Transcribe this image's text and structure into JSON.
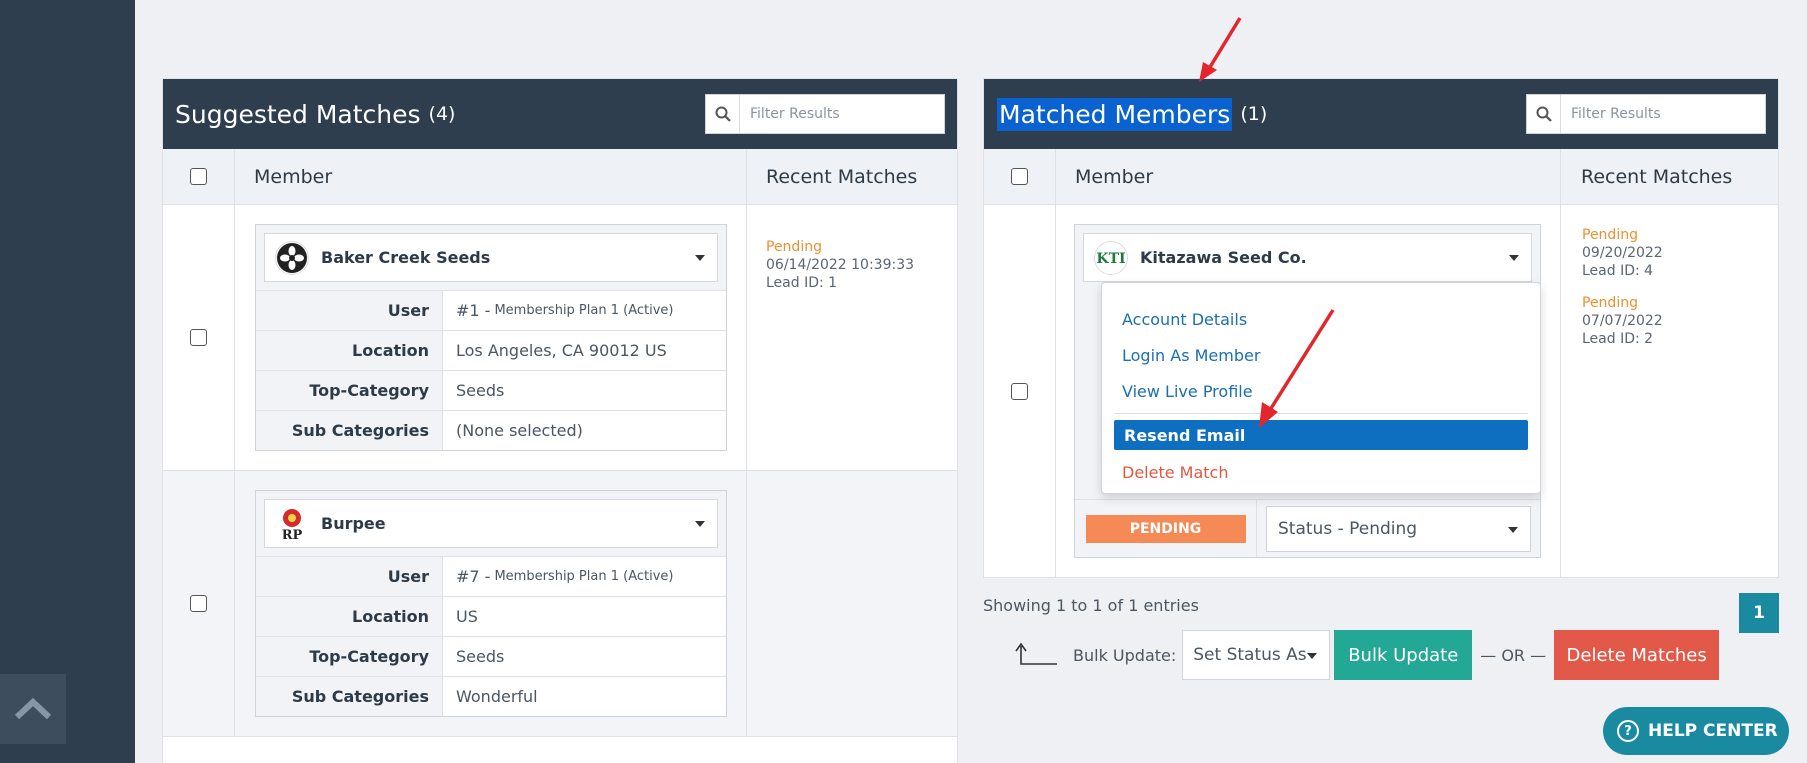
{
  "suggested": {
    "title": "Suggested Matches",
    "count": "(4)",
    "filter_placeholder": "Filter Results",
    "col_member": "Member",
    "col_recent": "Recent Matches",
    "rows": [
      {
        "name": "Baker Creek Seeds",
        "user_label": "User",
        "user_value": "#1 -",
        "user_plan": "Membership Plan 1 (Active)",
        "location_label": "Location",
        "location_value": "Los Angeles, CA 90012 US",
        "topcat_label": "Top-Category",
        "topcat_value": "Seeds",
        "subcat_label": "Sub Categories",
        "subcat_value": "(None selected)",
        "recent_status": "Pending",
        "recent_date": "06/14/2022 10:39:33",
        "recent_lead": "Lead ID: 1"
      },
      {
        "name": "Burpee",
        "user_label": "User",
        "user_value": "#7 -",
        "user_plan": "Membership Plan 1 (Active)",
        "location_label": "Location",
        "location_value": "US",
        "topcat_label": "Top-Category",
        "topcat_value": "Seeds",
        "subcat_label": "Sub Categories",
        "subcat_value": "Wonderful"
      }
    ]
  },
  "matched": {
    "title": "Matched Members",
    "count": "(1)",
    "filter_placeholder": "Filter Results",
    "col_member": "Member",
    "col_recent": "Recent Matches",
    "row": {
      "name": "Kitazawa Seed Co.",
      "logo_text": "KTI",
      "status_badge": "PENDING",
      "status_select": "Status - Pending",
      "recent": [
        {
          "status": "Pending",
          "date": "09/20/2022",
          "lead": "Lead ID: 4"
        },
        {
          "status": "Pending",
          "date": "07/07/2022",
          "lead": "Lead ID: 2"
        }
      ]
    },
    "dropdown": {
      "account_details": "Account Details",
      "login_as_member": "Login As Member",
      "view_live_profile": "View Live Profile",
      "resend_email": "Resend Email",
      "delete_match": "Delete Match"
    },
    "showing": "Showing 1 to 1 of 1 entries",
    "page": "1",
    "bulk_label": "Bulk Update:",
    "bulk_select": "Set Status As",
    "bulk_button": "Bulk Update",
    "or_text": "— OR —",
    "delete_button": "Delete Matches"
  },
  "help": {
    "label": "HELP CENTER",
    "icon": "question-circle-icon"
  },
  "colors": {
    "navy": "#2e3e4f",
    "teal": "#1a8aa0",
    "orange": "#ef8f2e",
    "red": "#e2594a",
    "link": "#1a6fb3"
  }
}
